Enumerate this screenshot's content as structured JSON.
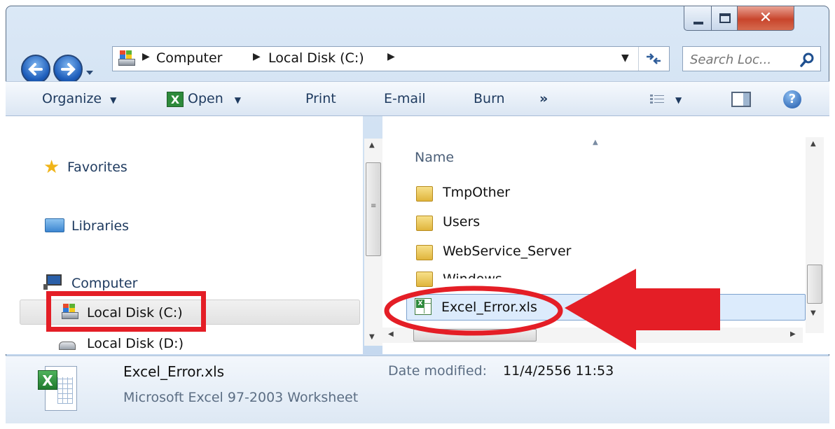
{
  "breadcrumb": [
    "Computer",
    "Local Disk (C:)"
  ],
  "search": {
    "placeholder": "Search Loc..."
  },
  "toolbar": {
    "organize": "Organize",
    "open": "Open",
    "print": "Print",
    "email": "E-mail",
    "burn": "Burn",
    "more": "»"
  },
  "nav_pane": {
    "favorites": "Favorites",
    "libraries": "Libraries",
    "computer": "Computer",
    "local_disk_c": "Local Disk (C:)",
    "local_disk_d": "Local Disk (D:)"
  },
  "file_list": {
    "column_name": "Name",
    "items": [
      {
        "name": "TmpOther",
        "type": "folder"
      },
      {
        "name": "Users",
        "type": "folder"
      },
      {
        "name": "WebService_Server",
        "type": "folder"
      },
      {
        "name": "Windows",
        "type": "folder"
      },
      {
        "name": "Excel_Error.xls",
        "type": "excel",
        "selected": true
      }
    ]
  },
  "details": {
    "filename": "Excel_Error.xls",
    "filetype": "Microsoft Excel 97-2003 Worksheet",
    "date_label": "Date modified:",
    "date_value": "11/4/2556 11:53"
  },
  "colors": {
    "annotation_red": "#e41e26",
    "selection_bg": "#dcebfc",
    "selection_border": "#7da2ce"
  }
}
